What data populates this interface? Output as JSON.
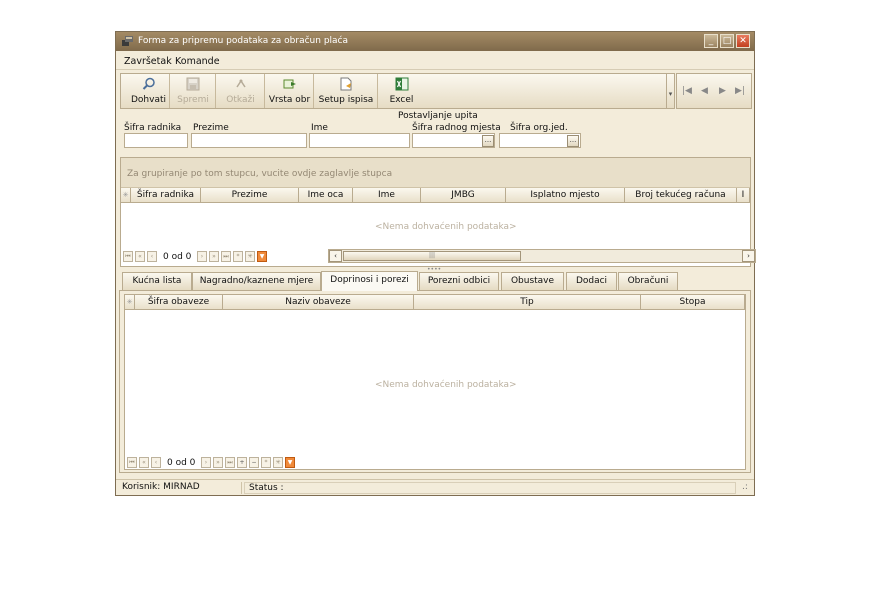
{
  "window": {
    "title": "Forma za pripremu podataka za obračun plaća"
  },
  "menu": [
    "Završetak",
    "Komande"
  ],
  "toolbar": {
    "buttons": [
      {
        "label": "Dohvati",
        "icon": "search-icon"
      },
      {
        "label": "Spremi",
        "icon": "save-icon"
      },
      {
        "label": "Otkaži",
        "icon": "cancel-icon"
      },
      {
        "label": "Vrsta obr",
        "icon": "calc-type-icon"
      },
      {
        "label": "Setup ispisa",
        "icon": "print-setup-icon"
      },
      {
        "label": "Excel",
        "icon": "excel-icon"
      }
    ]
  },
  "nav": {
    "first": "|◀",
    "prev": "◀",
    "next": "▶",
    "last": "▶|"
  },
  "query": {
    "heading": "Postavljanje upita",
    "sifra_radnika": "Šifra radnika",
    "prezime": "Prezime",
    "ime": "Ime",
    "sifra_radnog_mjesta": "Šifra radnog mjesta",
    "sifra_org_jed": "Šifra org.jed.",
    "ellipsis": "..."
  },
  "grid1": {
    "group_hint": "Za grupiranje po tom stupcu, vucite ovdje zaglavlje stupca",
    "columns": [
      "Šifra radnika",
      "Prezime",
      "Ime oca",
      "Ime",
      "JMBG",
      "Isplatno mjesto",
      "Broj tekućeg računa",
      "I"
    ],
    "empty": "<Nema dohvaćenih podataka>",
    "pager_text": "0 od 0"
  },
  "tabs": [
    {
      "label": "Kućna lista"
    },
    {
      "label": "Nagradno/kaznene mjere"
    },
    {
      "label": "Doprinosi i porezi"
    },
    {
      "label": "Porezni odbici"
    },
    {
      "label": "Obustave"
    },
    {
      "label": "Dodaci"
    },
    {
      "label": "Obračuni"
    }
  ],
  "active_tab": "Doprinosi i porezi",
  "grid2": {
    "columns": [
      "Šifra obaveze",
      "Naziv obaveze",
      "Tip",
      "Stopa"
    ],
    "empty": "<Nema dohvaćenih podataka>",
    "pager_text": "0 od 0"
  },
  "status": {
    "user": "Korisnik: MIRNAD",
    "status": "Status :"
  },
  "colors": {
    "title_bar": "#8f7a58",
    "window_bg": "#f3ecda",
    "close_button": "#d4552f",
    "filter_button": "#f08a3a"
  }
}
